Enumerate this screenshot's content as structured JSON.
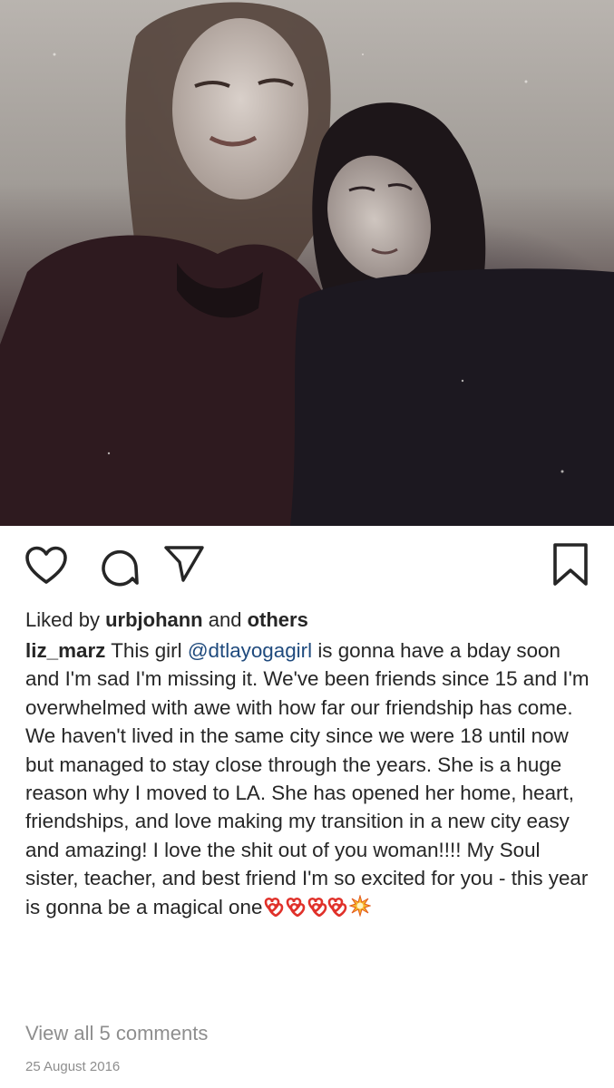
{
  "post": {
    "photo_icon": "photo-of-two-women",
    "likes": {
      "prefix": "Liked by",
      "user": "urbjohann",
      "middle": "and",
      "suffix": "others"
    },
    "caption": {
      "username": "liz_marz",
      "text_before": "This girl",
      "mention": "@dtlayogagirl",
      "text_after": "is gonna have a bday soon and I'm sad I'm missing it.  We've been friends since 15 and I'm overwhelmed with awe with how far our friendship has come.  We haven't lived in the same city since we were 18 until now but managed to stay close through the years.  She is a huge reason why I moved to LA. She has opened her home, heart, friendships, and love making my transition in a new city easy and amazing! I love the shit out of you woman!!!! My Soul sister, teacher, and best friend I'm so excited for you -  this year is gonna be a magical one",
      "emojis": "⟿⟿⟿⟿",
      "emoji_heart_icon": "double-heart-emoji",
      "emoji_boom_icon": "collision-emoji"
    },
    "view_comments": "View all 5 comments",
    "date": "25 August 2016"
  },
  "actions": {
    "like_icon": "heart-outline-icon",
    "comment_icon": "comment-bubble-icon",
    "share_icon": "paper-plane-icon",
    "save_icon": "bookmark-icon"
  },
  "colors": {
    "text": "#262626",
    "mention": "#1f4a7d",
    "muted": "#8e8e8e"
  }
}
